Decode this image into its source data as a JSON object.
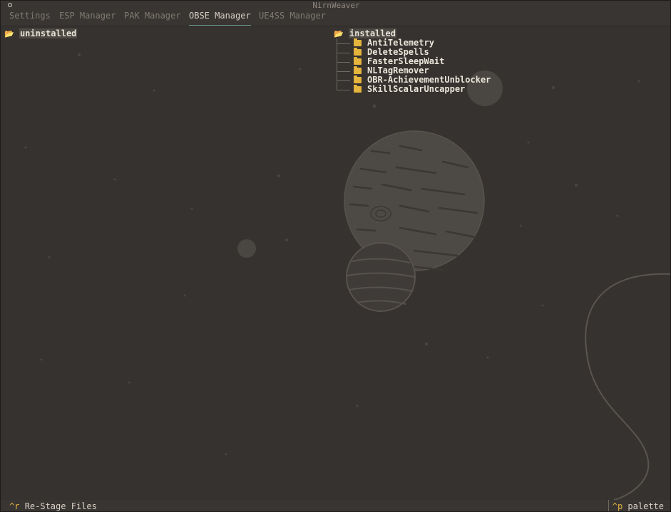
{
  "window": {
    "title": "NirnWeaver"
  },
  "tabs": [
    {
      "label": "Settings",
      "active": false
    },
    {
      "label": "ESP Manager",
      "active": false
    },
    {
      "label": "PAK Manager",
      "active": false
    },
    {
      "label": "OBSE Manager",
      "active": true
    },
    {
      "label": "UE4SS Manager",
      "active": false
    }
  ],
  "uninstalled": {
    "label": "uninstalled",
    "icon": "open-folder-icon"
  },
  "installed": {
    "label": "installed",
    "icon": "open-folder-icon",
    "items": [
      {
        "label": "AntiTelemetry",
        "icon": "folder-icon"
      },
      {
        "label": "DeleteSpells",
        "icon": "folder-icon"
      },
      {
        "label": "FasterSleepWait",
        "icon": "folder-icon"
      },
      {
        "label": "NLTagRemover",
        "icon": "folder-icon"
      },
      {
        "label": "OBR-AchievementUnblocker",
        "icon": "folder-icon"
      },
      {
        "label": "SkillScalarUncapper",
        "icon": "folder-icon"
      }
    ]
  },
  "footer": {
    "left_key": "^r",
    "left_label": "Re-Stage Files",
    "right_key": "^p",
    "right_label": "palette"
  },
  "colors": {
    "background": "#36322f",
    "accent_tab": "#6d9e97",
    "key_highlight": "#e3b341",
    "folder": "#e5b43c"
  }
}
